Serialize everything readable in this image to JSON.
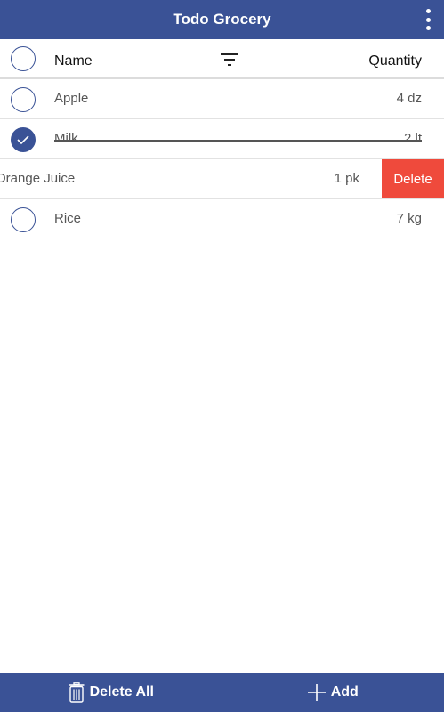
{
  "app": {
    "title": "Todo Grocery"
  },
  "header": {
    "name_label": "Name",
    "quantity_label": "Quantity"
  },
  "items": [
    {
      "name": "Apple",
      "quantity": "4 dz",
      "checked": false
    },
    {
      "name": "Milk",
      "quantity": "2 lt",
      "checked": true
    },
    {
      "name": "Orange Juice",
      "quantity": "1 pk",
      "checked": false,
      "swiped": true,
      "action": "Delete"
    },
    {
      "name": "Rice",
      "quantity": "7 kg",
      "checked": false
    }
  ],
  "bottom": {
    "delete_all_label": "Delete All",
    "add_label": "Add"
  },
  "colors": {
    "primary": "#3a5296",
    "delete": "#ef4a3c"
  },
  "icons": {
    "menu": "more-vert-icon",
    "filter": "filter-icon",
    "trash": "trash-icon",
    "add": "plus-icon",
    "check": "check-icon"
  }
}
